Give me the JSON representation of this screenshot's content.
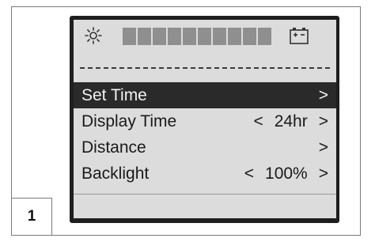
{
  "figure_number": "1",
  "status": {
    "brightness_icon": "sun-icon",
    "battery_icon": "battery-icon",
    "level_fraction": 1.0,
    "segment_count": 10
  },
  "menu": {
    "items": [
      {
        "label": "Set Time",
        "prev": "",
        "value": "",
        "next": ">",
        "selected": true
      },
      {
        "label": "Display Time",
        "prev": "<",
        "value": "24hr",
        "next": ">",
        "selected": false
      },
      {
        "label": "Distance",
        "prev": "",
        "value": "",
        "next": ">",
        "selected": false
      },
      {
        "label": "Backlight",
        "prev": "<",
        "value": "100%",
        "next": ">",
        "selected": false
      }
    ]
  }
}
